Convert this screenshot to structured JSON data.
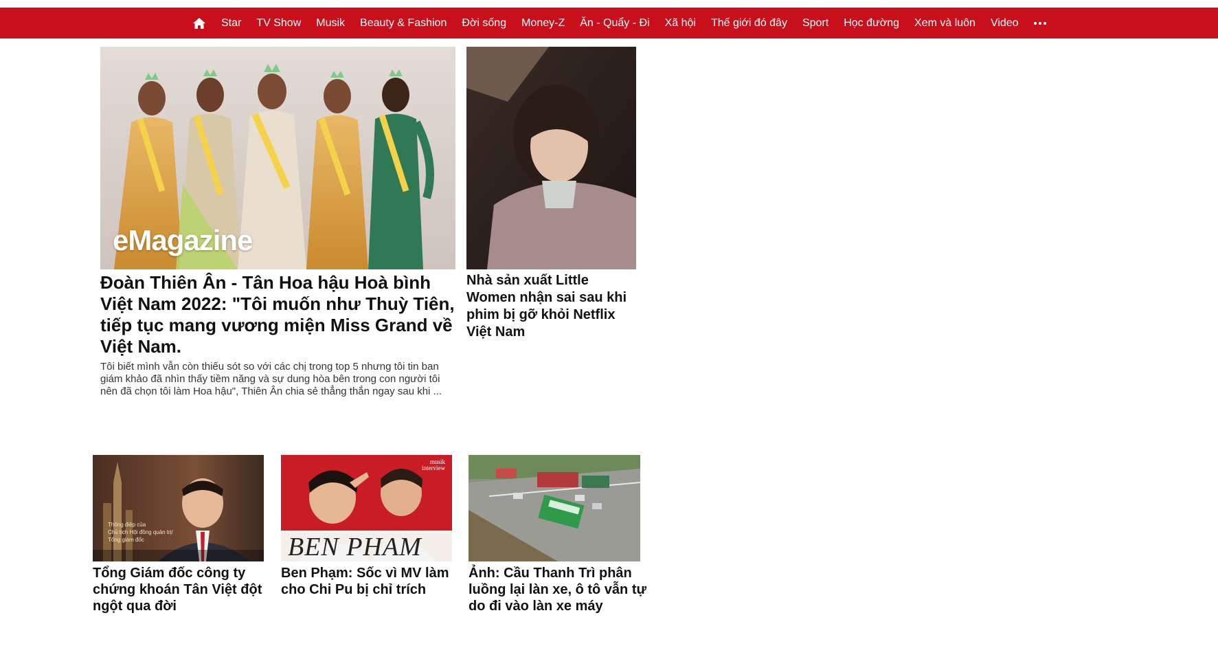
{
  "nav": {
    "home_icon": "home-icon",
    "items": [
      "Star",
      "TV Show",
      "Musik",
      "Beauty & Fashion",
      "Đời sống",
      "Money-Z",
      "Ăn - Quẩy - Đi",
      "Xã hội",
      "Thế giới đó đây",
      "Sport",
      "Học đường",
      "Xem và luôn",
      "Video"
    ],
    "more_icon": "more-dots-icon",
    "bar_color": "#c8101c"
  },
  "featured": {
    "image_badge": "eMagazine",
    "title": "Đoàn Thiên Ân - Tân Hoa hậu Hoà bình Việt Nam 2022: \"Tôi muốn như Thuỳ Tiên, tiếp tục mang vương miện Miss Grand về Việt Nam.",
    "sapo": "Tôi biết mình vẫn còn thiếu sót so với các chị trong top 5 nhưng tôi tin ban giám khảo đã nhìn thấy tiềm năng và sự dung hòa bên trong con người tôi nên đã chọn tôi làm Hoa hậu\", Thiên Ân chia sẻ thẳng thắn ngay sau khi ..."
  },
  "side_story": {
    "title": "Nhà sản xuất Little Women nhận sai sau khi phim bị gỡ khỏi Netflix Việt Nam"
  },
  "stories": [
    {
      "title": "Tổng Giám đốc công ty chứng khoán Tân Việt đột ngột qua đời",
      "image_caption_1": "Thông điệp của",
      "image_caption_2": "Chủ tịch Hội đồng quản trị/",
      "image_caption_3": "Tổng giám đốc"
    },
    {
      "title": "Ben Phạm: Sốc vì MV làm cho Chi Pu bị chỉ trích",
      "image_text": "BEN PHAM",
      "image_badge_1": "musik",
      "image_badge_2": "interview"
    },
    {
      "title": "Ảnh: Cầu Thanh Trì phân luồng lại làn xe, ô tô vẫn tự do đi vào làn xe máy"
    }
  ]
}
